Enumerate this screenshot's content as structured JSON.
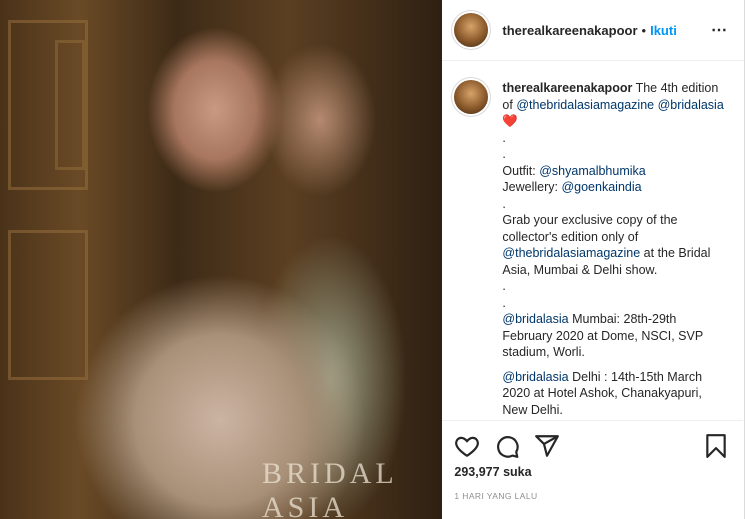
{
  "post": {
    "username": "therealkareenakapoor",
    "follow_label": "Ikuti",
    "separator": "•",
    "more_icon": "⋯",
    "media_watermark": "BRIDAL ASIA",
    "caption": {
      "username": "therealkareenakapoor",
      "line_intro": "The 4th edition of",
      "tag_mag": "@thebridalasiamagazine",
      "tag_ba": "@bridalasia",
      "heart": "❤️",
      "dot": ".",
      "outfit_label": "Outfit:",
      "outfit_tag": "@shyamalbhumika",
      "jewellery_label": "Jewellery:",
      "jewellery_tag": "@goenkaindia",
      "grab_text": "Grab your exclusive copy of the collector's edition only of",
      "grab_tag": "@thebridalasiamagazine",
      "grab_tail": "at the Bridal Asia, Mumbai & Delhi show.",
      "mumbai_tag": "@bridalasia",
      "mumbai_text": "Mumbai: 28th-29th February 2020 at Dome, NSCI, SVP stadium, Worli.",
      "delhi_tag": "@bridalasia",
      "delhi_text": "Delhi : 14th-15th March 2020 at Hotel Ashok, Chanakyapuri, New Delhi."
    },
    "likes": "293,977 suka",
    "timestamp": "1 HARI YANG LALU",
    "icons": {
      "like": "heart-icon",
      "comment": "comment-icon",
      "share": "share-icon",
      "save": "bookmark-icon"
    }
  }
}
